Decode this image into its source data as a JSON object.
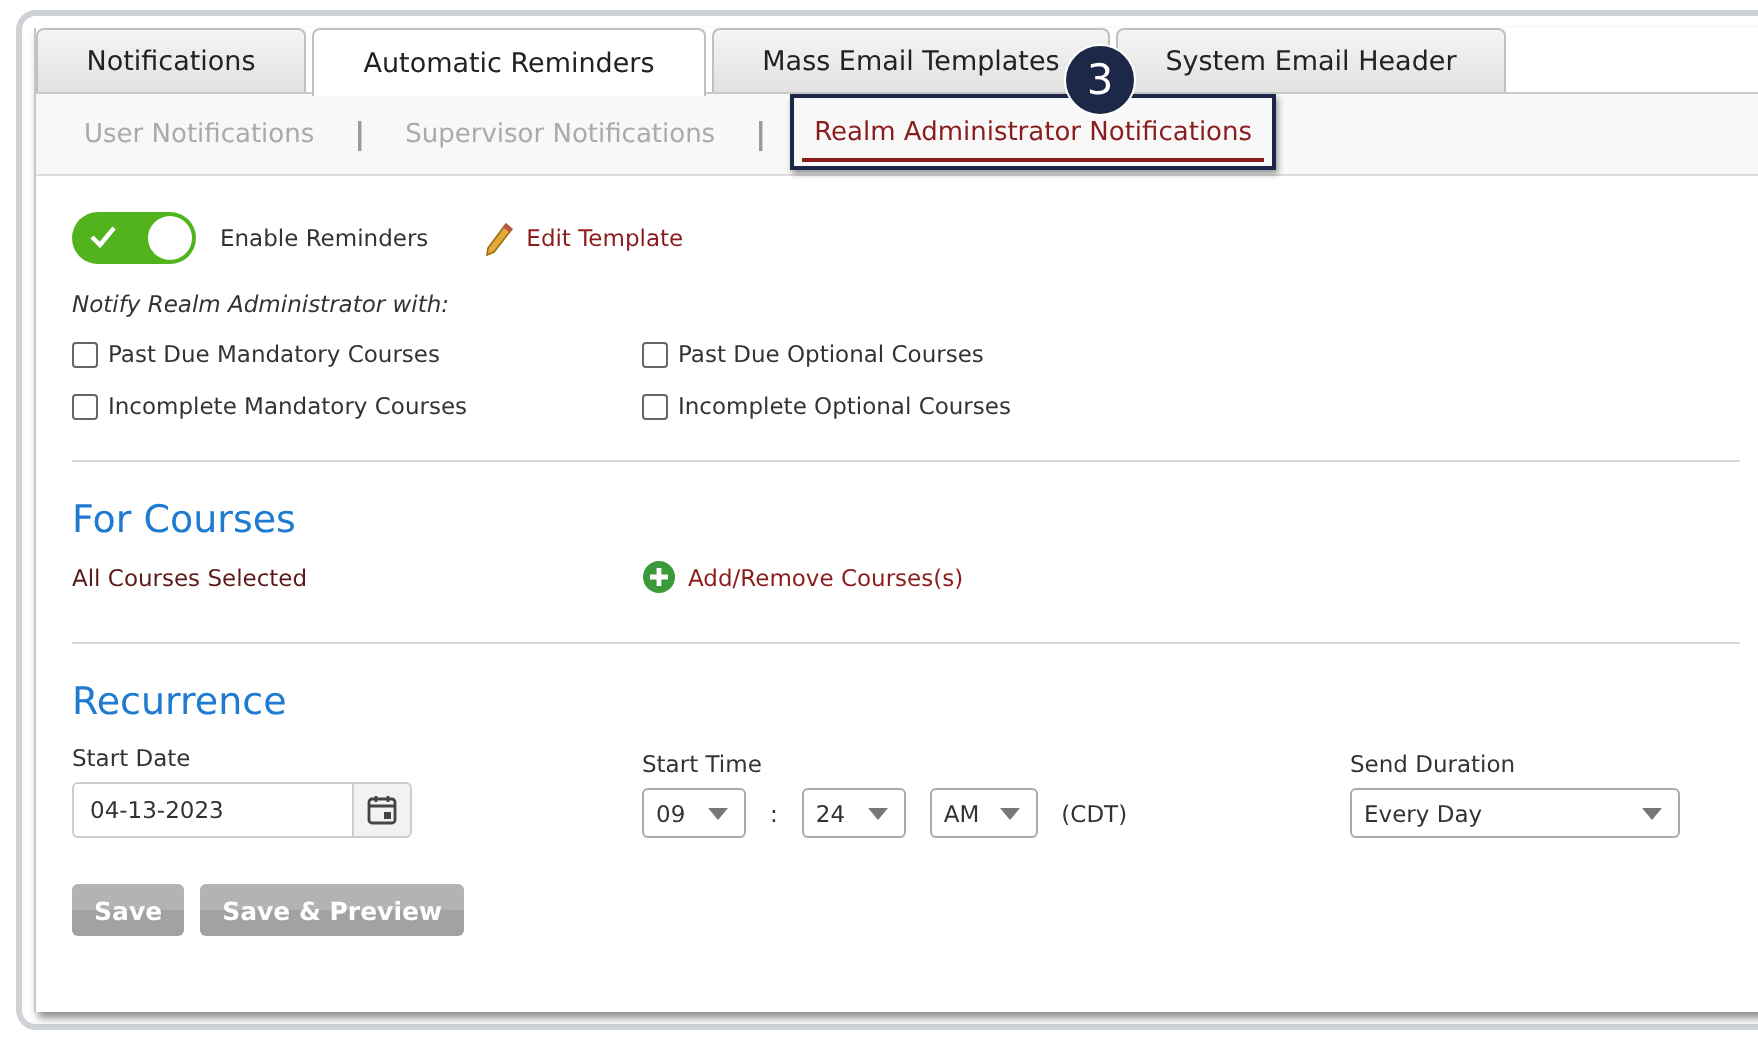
{
  "tabs": [
    {
      "label": "Notifications",
      "selected": false
    },
    {
      "label": "Automatic Reminders",
      "selected": true
    },
    {
      "label": "Mass Email Templates",
      "selected": false
    },
    {
      "label": "System Email Header",
      "selected": false
    }
  ],
  "subtabs": [
    {
      "label": "User Notifications",
      "selected": false
    },
    {
      "label": "Supervisor Notifications",
      "selected": false
    },
    {
      "label": "Realm Administrator Notifications",
      "selected": true
    }
  ],
  "subtab_separator": "|",
  "callout": {
    "number": "3"
  },
  "toggle": {
    "label": "Enable Reminders",
    "on": true
  },
  "edit_link": "Edit Template",
  "notify_label": "Notify Realm Administrator with:",
  "checkboxes": [
    {
      "label": "Past Due Mandatory Courses",
      "checked": false
    },
    {
      "label": "Past Due Optional Courses",
      "checked": false
    },
    {
      "label": "Incomplete Mandatory Courses",
      "checked": false
    },
    {
      "label": "Incomplete Optional Courses",
      "checked": false
    }
  ],
  "for_courses": {
    "heading": "For Courses",
    "status": "All Courses Selected",
    "link": "Add/Remove Courses(s)"
  },
  "recurrence": {
    "heading": "Recurrence",
    "start_date": {
      "label": "Start Date",
      "value": "04-13-2023"
    },
    "start_time": {
      "label": "Start Time",
      "hour": "09",
      "separator": ":",
      "minute": "24",
      "period": "AM",
      "timezone": "(CDT)"
    },
    "send_duration": {
      "label": "Send Duration",
      "value": "Every Day"
    }
  },
  "buttons": [
    {
      "label": "Save",
      "disabled": true
    },
    {
      "label": "Save & Preview",
      "disabled": true
    }
  ]
}
